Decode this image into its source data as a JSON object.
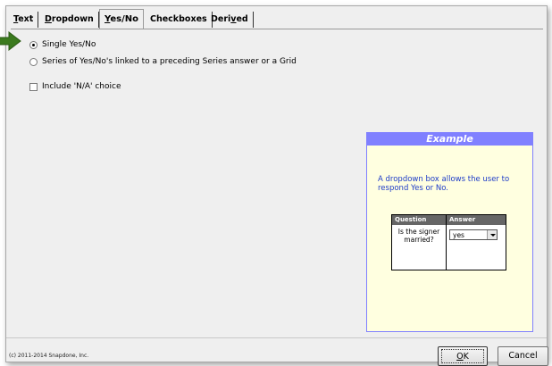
{
  "tabs": [
    {
      "label": "Text",
      "mnemonic": "T"
    },
    {
      "label": "Dropdown",
      "mnemonic": "D"
    },
    {
      "label": "Yes/No",
      "mnemonic": "Y",
      "active": true
    },
    {
      "label": "Checkboxes"
    },
    {
      "label": "Derived",
      "mnemonic": "v"
    }
  ],
  "options": {
    "single": {
      "label": "Single Yes/No",
      "selected": true
    },
    "series": {
      "label": "Series of Yes/No's linked to a preceding Series answer or a Grid",
      "selected": false
    },
    "na": {
      "label": "Include 'N/A' choice",
      "checked": false
    }
  },
  "example": {
    "title": "Example",
    "description": "A dropdown box allows the user to respond Yes or No.",
    "table": {
      "headers": [
        "Question",
        "Answer"
      ],
      "question": "Is the signer married?",
      "answer": "yes"
    }
  },
  "footer": {
    "copyright": "(c) 2011-2014 Snapdone, Inc.",
    "ok_label": "OK",
    "cancel_label": "Cancel"
  },
  "colors": {
    "arrow": "#3b7a1e",
    "example_header": "#8080ff",
    "example_bg": "#ffffe0",
    "example_text": "#1e3cc8"
  }
}
